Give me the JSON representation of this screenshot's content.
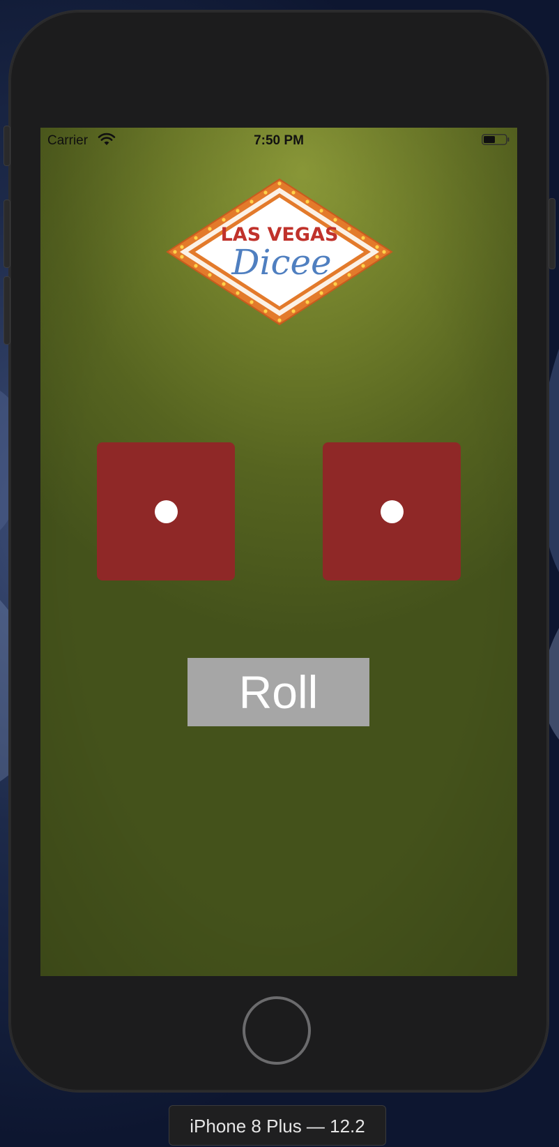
{
  "status_bar": {
    "carrier": "Carrier",
    "time": "7:50 PM"
  },
  "logo": {
    "line1": "LAS VEGAS",
    "line2": "Dicee",
    "colors": {
      "line1": "#c0322b",
      "line2": "#4f7fc0",
      "frame": "#e07a2a"
    }
  },
  "dice": [
    {
      "value": 1,
      "color": "#8f2827"
    },
    {
      "value": 1,
      "color": "#8f2827"
    }
  ],
  "roll_button": {
    "label": "Roll"
  },
  "device_label": "iPhone 8 Plus — 12.2"
}
